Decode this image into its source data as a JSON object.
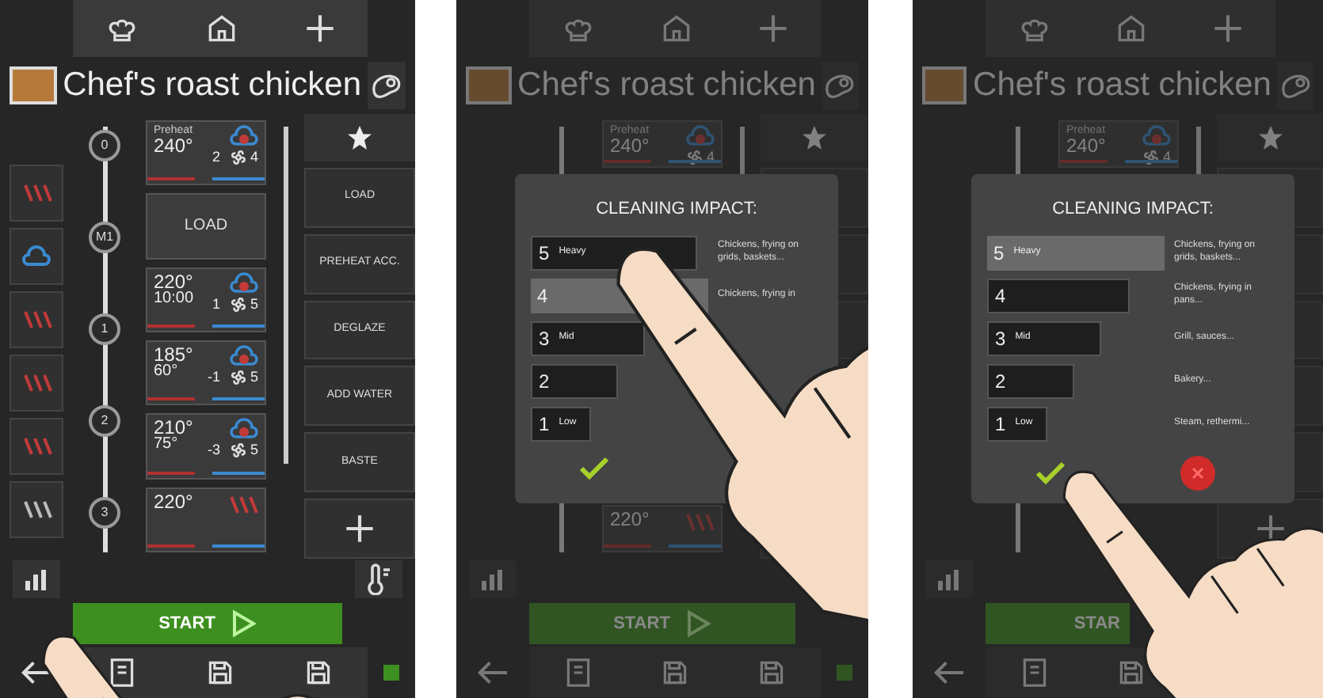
{
  "screens": [
    {
      "title": "Chef's roast chicken",
      "timeline": [
        "0",
        "M1",
        "1",
        "2",
        "3"
      ],
      "steps": [
        {
          "kind": "preheat",
          "label": "Preheat",
          "temp": "240°",
          "fan": "4",
          "value": "2"
        },
        {
          "kind": "load",
          "label": "LOAD"
        },
        {
          "kind": "step",
          "temp": "220°",
          "time": "10:00",
          "fan": "5",
          "value": "1"
        },
        {
          "kind": "step",
          "temp": "185°",
          "time": "60°",
          "fan": "5",
          "value": "-1"
        },
        {
          "kind": "step",
          "temp": "210°",
          "time": "75°",
          "fan": "5",
          "value": "-3"
        },
        {
          "kind": "step",
          "temp": "220°"
        }
      ],
      "side_buttons": [
        "LOAD",
        "PREHEAT ACC.",
        "DEGLAZE",
        "ADD WATER",
        "BASTE"
      ],
      "start": "START",
      "start_play_icon": true
    },
    {
      "title": "Chef's roast chicken",
      "steps": [
        {
          "kind": "preheat",
          "label": "Preheat",
          "temp": "240°",
          "fan": "4"
        },
        {
          "kind": "step",
          "temp": "220°"
        }
      ],
      "start": "START",
      "start_play_icon": true,
      "dialog": {
        "title": "CLEANING IMPACT:",
        "levels": [
          {
            "number": "5",
            "label": "Heavy",
            "description": "Chickens, frying on grids, baskets...",
            "selected": false
          },
          {
            "number": "4",
            "description": "Chickens, frying in",
            "selected": true
          },
          {
            "number": "3",
            "label": "Mid",
            "selected": false
          },
          {
            "number": "2",
            "selected": false
          },
          {
            "number": "1",
            "label": "Low",
            "selected": false
          }
        ]
      }
    },
    {
      "title": "Chef's roast chicken",
      "steps": [
        {
          "kind": "preheat",
          "label": "Preheat",
          "temp": "240°",
          "fan": "4"
        }
      ],
      "start": "STAR",
      "dialog": {
        "title": "CLEANING IMPACT:",
        "cancel": true,
        "levels": [
          {
            "number": "5",
            "label": "Heavy",
            "description": "Chickens, frying on grids, baskets...",
            "selected": true
          },
          {
            "number": "4",
            "description": "Chickens, frying in pans...",
            "selected": false
          },
          {
            "number": "3",
            "label": "Mid",
            "description": "Grill, sauces...",
            "selected": false
          },
          {
            "number": "2",
            "description": "Bakery...",
            "selected": false
          },
          {
            "number": "1",
            "label": "Low",
            "description": "Steam, rethermi...",
            "selected": false
          }
        ]
      }
    }
  ]
}
